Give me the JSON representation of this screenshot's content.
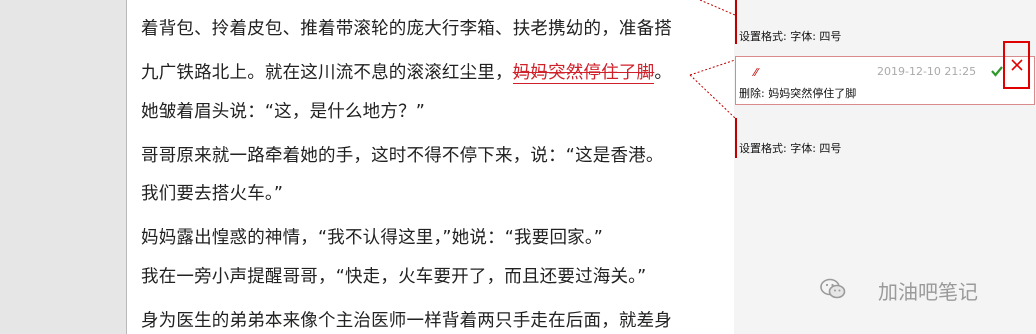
{
  "document": {
    "lines": [
      "着背包、拎着皮包、推着带滚轮的庞大行李箱、扶老携幼的，准备搭",
      "九广铁路北上。就在这川流不息的滚滚红尘里，",
      "她皱着眉头说：“这，是什么地方？”",
      "哥哥原来就一路牵着她的手，这时不得不停下来，说：“这是香港。",
      "我们要去搭火车。”",
      "妈妈露出惶惑的神情，“我不认得这里，”她说：“我要回家。”",
      "我在一旁小声提醒哥哥，“快走，火车要开了，而且还要过海关。”",
      "身为医生的弟弟本来像个主治医师一样背着两只手走在后面，就差身"
    ],
    "deleted_text": "妈妈突然停住了脚",
    "line2_tail": "。"
  },
  "markup": {
    "format_label_1": "设置格式: 字体: 四号",
    "format_label_2": "设置格式: 字体: 四号",
    "comment": {
      "author": "⁄⁄",
      "time": "2019-12-10 21:25",
      "text": "删除: 妈妈突然停住了脚"
    }
  },
  "watermark": "加油吧笔记",
  "colors": {
    "accent_red": "#c00000",
    "accept_green": "#2e9a2e",
    "reject_red": "#e00000"
  },
  "icons": [
    "accept-check-icon",
    "reject-x-icon",
    "wechat-icon"
  ]
}
